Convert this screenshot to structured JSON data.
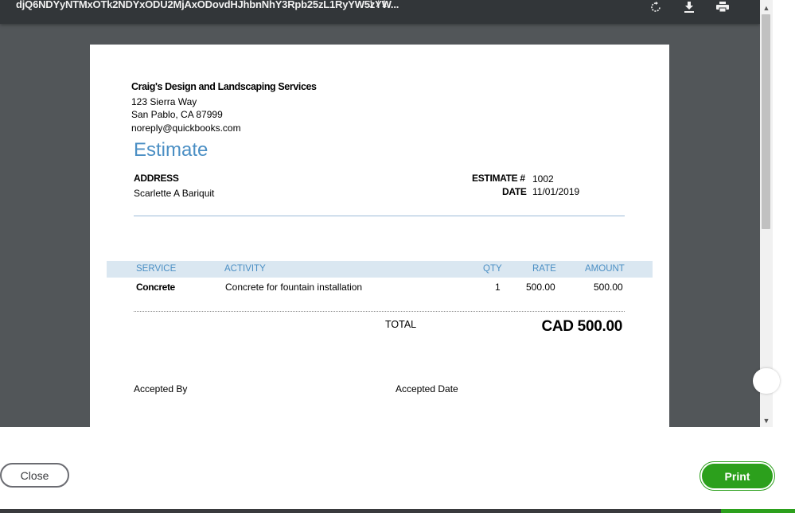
{
  "viewer": {
    "doc_title": "djQ6NDYyNTMxOTk2NDYxODU2MjAxODovdHJhbnNhY3Rpb25zL1RyYW5zYW...",
    "page_count": "1 / 1",
    "icons": {
      "rotate": "rotate-icon",
      "download": "download-icon",
      "print": "print-icon"
    }
  },
  "company": {
    "name": "Craig's Design and Landscaping Services",
    "address1": "123 Sierra Way",
    "address2": "San Pablo, CA  87999",
    "email": "noreply@quickbooks.com"
  },
  "estimate": {
    "heading": "Estimate",
    "address_label": "ADDRESS",
    "customer": "Scarlette A Bariquit",
    "number_label": "ESTIMATE #",
    "number": "1002",
    "date_label": "DATE",
    "date": "11/01/2019"
  },
  "table": {
    "headers": {
      "service": "SERVICE",
      "activity": "ACTIVITY",
      "qty": "QTY",
      "rate": "RATE",
      "amount": "AMOUNT"
    },
    "rows": [
      {
        "service": "Concrete",
        "activity": "Concrete for fountain installation",
        "qty": "1",
        "rate": "500.00",
        "amount": "500.00"
      }
    ]
  },
  "totals": {
    "label": "TOTAL",
    "value": "CAD 500.00"
  },
  "signature": {
    "accepted_by": "Accepted By",
    "accepted_date": "Accepted Date"
  },
  "footer": {
    "close_label": "Close",
    "print_label": "Print"
  },
  "colors": {
    "accent": "#4b8fc4",
    "print_button": "#2ca01c",
    "header_row": "#dae7f1"
  }
}
